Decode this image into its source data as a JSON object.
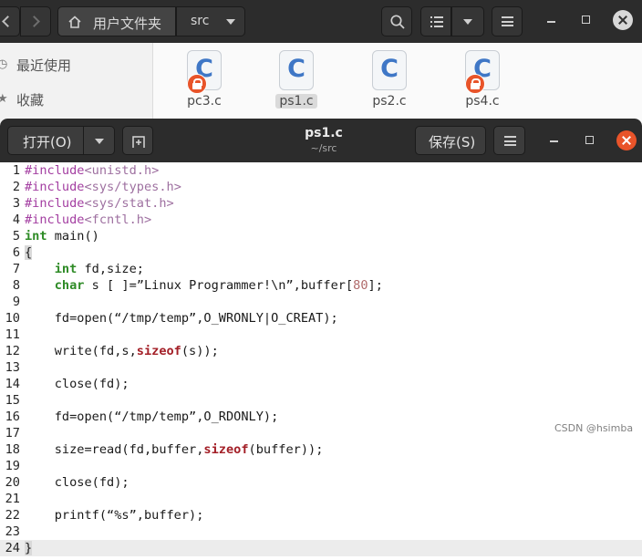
{
  "file_manager": {
    "path": {
      "home_label": "用户文件夹",
      "current": "src"
    },
    "sidebar": [
      {
        "icon": "clock-icon",
        "label": "最近使用"
      },
      {
        "icon": "star-icon",
        "label": "收藏"
      }
    ],
    "files": [
      {
        "name": "pc3.c",
        "letter": "C",
        "locked": true,
        "selected": false
      },
      {
        "name": "ps1.c",
        "letter": "C",
        "locked": false,
        "selected": true
      },
      {
        "name": "ps2.c",
        "letter": "C",
        "locked": false,
        "selected": false
      },
      {
        "name": "ps4.c",
        "letter": "C",
        "locked": true,
        "selected": false
      }
    ]
  },
  "editor": {
    "open_label": "打开(O)",
    "title": "ps1.c",
    "subtitle": "~/src",
    "save_label": "保存(S)",
    "current_line": 24,
    "lines": [
      "#include<unistd.h>",
      "#include<sys/types.h>",
      "#include<sys/stat.h>",
      "#include<fcntl.h>",
      "int main()",
      "{",
      "    int fd,size;",
      "    char s [ ]=”Linux Programmer!\\n”,buffer[80];",
      "",
      "    fd=open(“/tmp/temp”,O_WRONLY|O_CREAT);",
      "",
      "    write(fd,s,sizeof(s));",
      "",
      "    close(fd);",
      "",
      "    fd=open(“/tmp/temp”,O_RDONLY);",
      "",
      "    size=read(fd,buffer,sizeof(buffer));",
      "",
      "    close(fd);",
      "",
      "    printf(“%s”,buffer);",
      "",
      "}"
    ]
  },
  "watermark": "CSDN @hsimba",
  "colors": {
    "accent_close": "#e9542a",
    "lock_badge": "#e8542a",
    "keyword": "#2e8b26",
    "preprocessor": "#a33ea1",
    "function": "#a31f27"
  }
}
